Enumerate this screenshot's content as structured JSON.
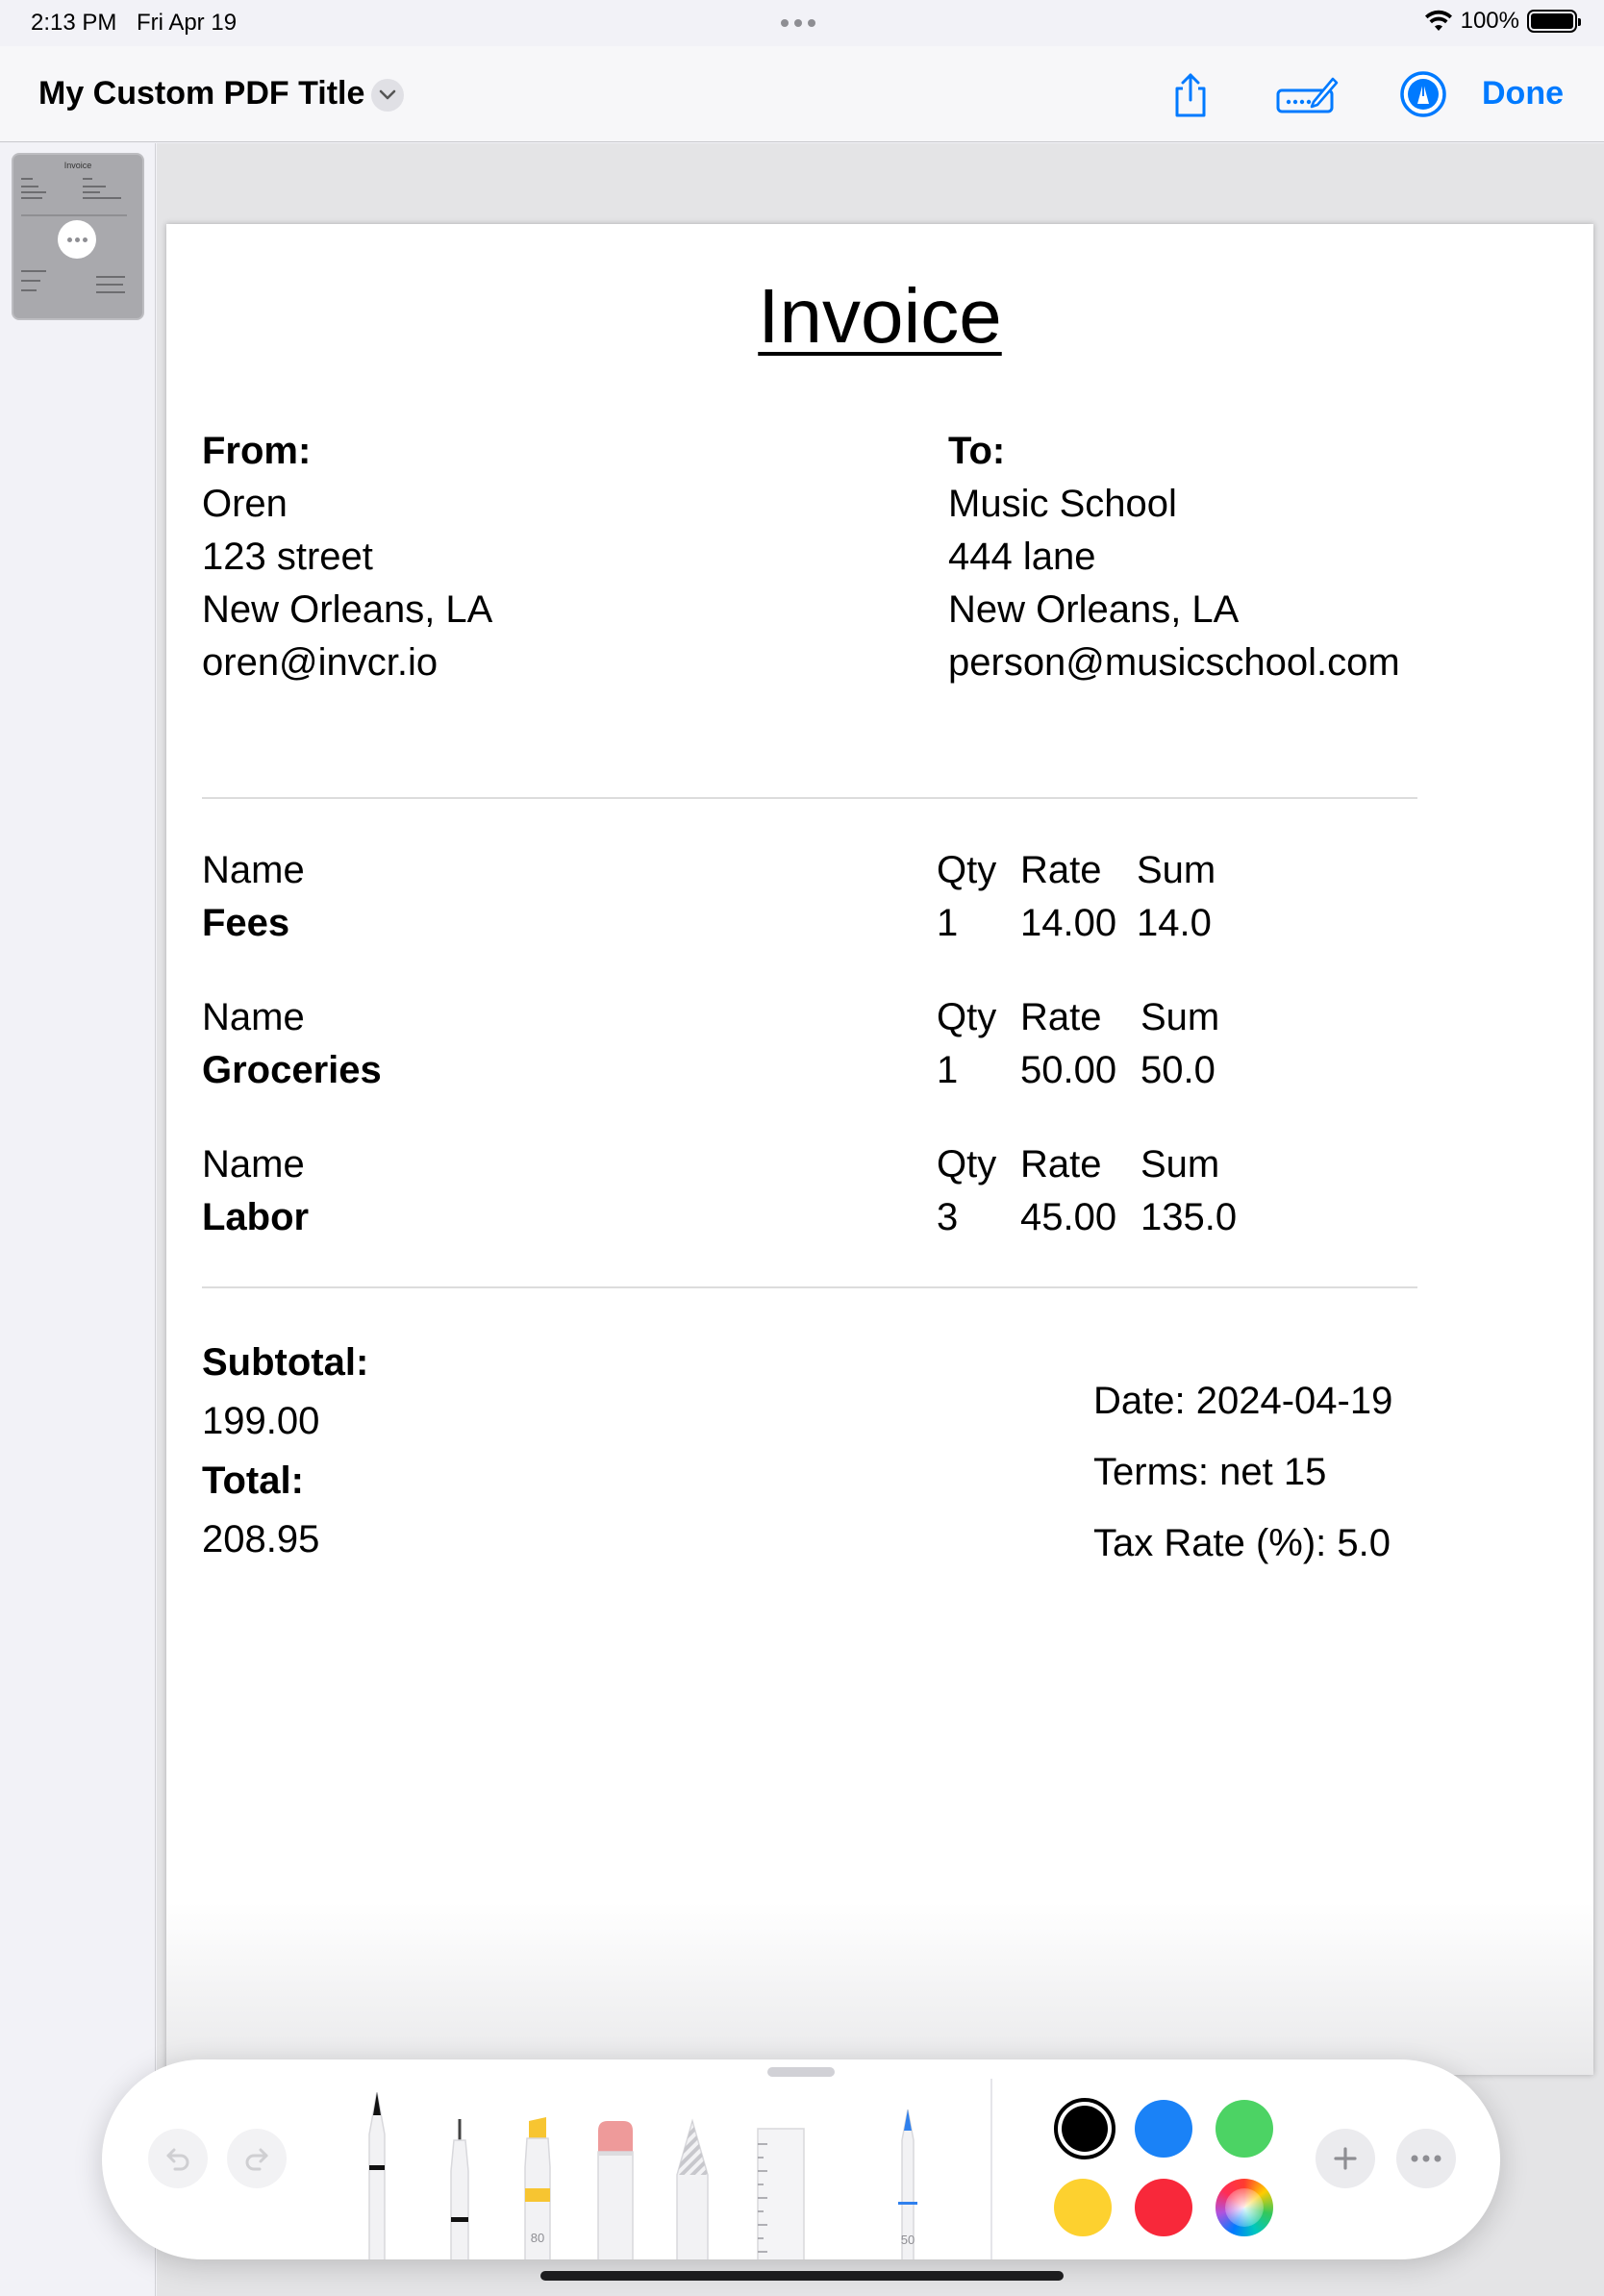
{
  "status_bar": {
    "time": "2:13 PM",
    "date": "Fri Apr 19",
    "battery_text": "100%",
    "battery_level": 1.0
  },
  "nav": {
    "title": "My Custom PDF Title",
    "done_label": "Done",
    "accent_color": "#007aff"
  },
  "thumbnail": {
    "title": "Invoice"
  },
  "invoice": {
    "title": "Invoice",
    "from": {
      "label": "From:",
      "name": "Oren",
      "street": "123 street",
      "city": "New Orleans, LA",
      "email": "oren@invcr.io"
    },
    "to": {
      "label": "To:",
      "name": "Music School",
      "street": "444 lane",
      "city": "New Orleans, LA",
      "email": "person@musicschool.com"
    },
    "items": [
      {
        "name_label": "Name",
        "name": "Fees",
        "qty_label": "Qty",
        "rate_label": "Rate",
        "sum_label": "Sum",
        "qty": "1",
        "rate": "14.00",
        "sum": "14.0"
      },
      {
        "name_label": "Name",
        "name": "Groceries",
        "qty_label": "Qty",
        "rate_label": "Rate",
        "sum_label": "Sum",
        "qty": "1",
        "rate": "50.00",
        "sum": "50.0"
      },
      {
        "name_label": "Name",
        "name": "Labor",
        "qty_label": "Qty",
        "rate_label": "Rate",
        "sum_label": "Sum",
        "qty": "3",
        "rate": "45.00",
        "sum": "135.0"
      }
    ],
    "subtotal_label": "Subtotal:",
    "subtotal": "199.00",
    "total_label": "Total:",
    "total": "208.95",
    "date": "Date: 2024-04-19",
    "terms": "Terms: net 15",
    "tax_rate": "Tax Rate (%): 5.0"
  },
  "toolbar": {
    "tools": [
      {
        "name": "pen",
        "label": ""
      },
      {
        "name": "fineliner",
        "label": ""
      },
      {
        "name": "highlighter",
        "label": "80"
      },
      {
        "name": "eraser",
        "label": ""
      },
      {
        "name": "lasso",
        "label": ""
      },
      {
        "name": "ruler",
        "label": ""
      },
      {
        "name": "pencil",
        "label": "50"
      }
    ],
    "colors": {
      "black": "#000000",
      "blue": "#1a82f7",
      "green": "#4cd364",
      "yellow": "#fdd12f",
      "red": "#f8283a"
    },
    "selected_color": "black"
  }
}
